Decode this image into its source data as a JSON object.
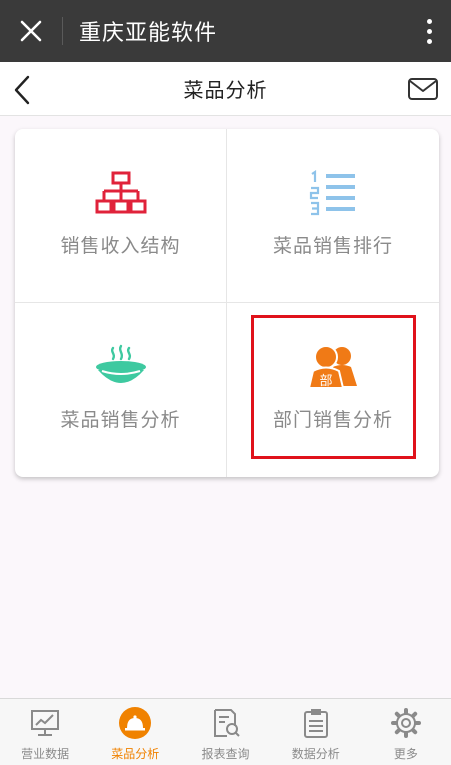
{
  "app_bar": {
    "title": "重庆亚能软件"
  },
  "header": {
    "title": "菜品分析"
  },
  "grid": {
    "items": [
      {
        "label": "销售收入结构",
        "icon": "org-chart-icon",
        "color": "#e0223a"
      },
      {
        "label": "菜品销售排行",
        "icon": "numbered-list-icon",
        "color": "#8ec3ea"
      },
      {
        "label": "菜品销售分析",
        "icon": "dish-bowl-icon",
        "color": "#3ec9a0"
      },
      {
        "label": "部门销售分析",
        "icon": "department-people-icon",
        "color": "#f07a16",
        "badge": "部"
      }
    ]
  },
  "tabbar": {
    "items": [
      {
        "label": "营业数据",
        "icon": "monitor-chart-icon",
        "active": false
      },
      {
        "label": "菜品分析",
        "icon": "cloche-icon",
        "active": true
      },
      {
        "label": "报表查询",
        "icon": "report-search-icon",
        "active": false
      },
      {
        "label": "数据分析",
        "icon": "clipboard-icon",
        "active": false
      },
      {
        "label": "更多",
        "icon": "gear-icon",
        "active": false
      }
    ]
  },
  "colors": {
    "active": "#f08200",
    "inactive_tab": "#8a8a8a",
    "highlight": "#e0121b"
  }
}
